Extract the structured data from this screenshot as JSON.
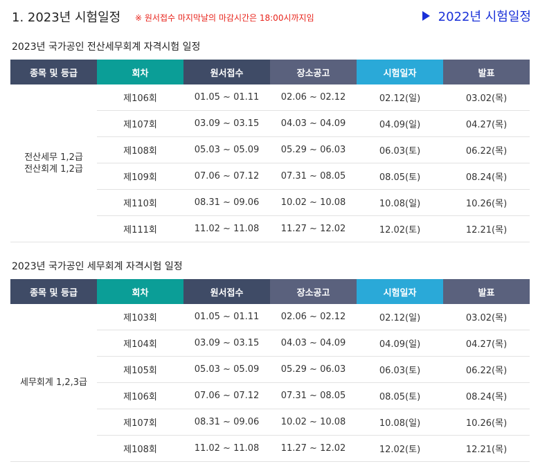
{
  "header": {
    "title": "1. 2023년 시험일정",
    "note": "※ 원서접수 마지막날의 마감시간은 18:00시까지임",
    "prev_link": "2022년 시험일정"
  },
  "columns": [
    "종목 및 등급",
    "회차",
    "원서접수",
    "장소공고",
    "시험일자",
    "발표"
  ],
  "colors": {
    "header_dark": "#3f4b66",
    "header_teal": "#0b9e97",
    "header_slate": "#5a617d",
    "header_sky": "#2aa9d8",
    "weekday_red": "#e8231b",
    "saturday_blue": "#2c8fc0",
    "link_blue": "#1930d8"
  },
  "sections": [
    {
      "title": "2023년 국가공인 전산세무회계 자격시험 일정",
      "grade": "전산세무 1,2급\n전산회계 1,2급",
      "rows": [
        {
          "round": "제106회",
          "apply": "01.05 ~ 01.11",
          "venue": "02.06 ~ 02.12",
          "exam": "02.12(일)",
          "result": "03.02(목)"
        },
        {
          "round": "제107회",
          "apply": "03.09 ~ 03.15",
          "venue": "04.03 ~ 04.09",
          "exam": "04.09(일)",
          "result": "04.27(목)"
        },
        {
          "round": "제108회",
          "apply": "05.03 ~ 05.09",
          "venue": "05.29 ~ 06.03",
          "exam": "06.03(토)",
          "result": "06.22(목)"
        },
        {
          "round": "제109회",
          "apply": "07.06 ~ 07.12",
          "venue": "07.31 ~ 08.05",
          "exam": "08.05(토)",
          "result": "08.24(목)"
        },
        {
          "round": "제110회",
          "apply": "08.31 ~ 09.06",
          "venue": "10.02 ~ 10.08",
          "exam": "10.08(일)",
          "result": "10.26(목)"
        },
        {
          "round": "제111회",
          "apply": "11.02 ~ 11.08",
          "venue": "11.27 ~ 12.02",
          "exam": "12.02(토)",
          "result": "12.21(목)"
        }
      ]
    },
    {
      "title": "2023년 국가공인 세무회계 자격시험 일정",
      "grade": "세무회계 1,2,3급",
      "rows": [
        {
          "round": "제103회",
          "apply": "01.05 ~ 01.11",
          "venue": "02.06 ~ 02.12",
          "exam": "02.12(일)",
          "result": "03.02(목)"
        },
        {
          "round": "제104회",
          "apply": "03.09 ~ 03.15",
          "venue": "04.03 ~ 04.09",
          "exam": "04.09(일)",
          "result": "04.27(목)"
        },
        {
          "round": "제105회",
          "apply": "05.03 ~ 05.09",
          "venue": "05.29 ~ 06.03",
          "exam": "06.03(토)",
          "result": "06.22(목)"
        },
        {
          "round": "제106회",
          "apply": "07.06 ~ 07.12",
          "venue": "07.31 ~ 08.05",
          "exam": "08.05(토)",
          "result": "08.24(목)"
        },
        {
          "round": "제107회",
          "apply": "08.31 ~ 09.06",
          "venue": "10.02 ~ 10.08",
          "exam": "10.08(일)",
          "result": "10.26(목)"
        },
        {
          "round": "제108회",
          "apply": "11.02 ~ 11.08",
          "venue": "11.27 ~ 12.02",
          "exam": "12.02(토)",
          "result": "12.21(목)"
        }
      ]
    }
  ]
}
